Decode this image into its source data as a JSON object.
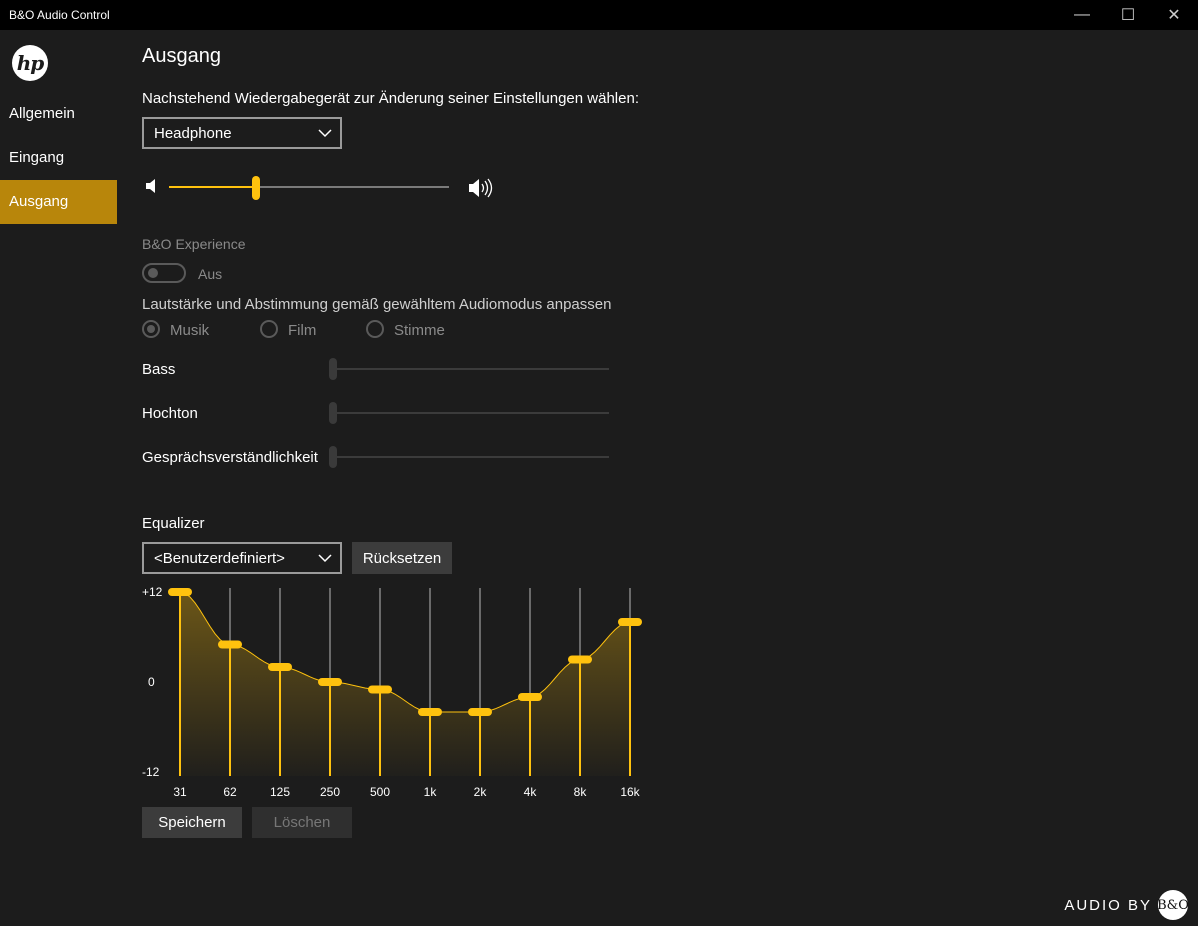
{
  "window": {
    "title": "B&O Audio Control",
    "minimize": "—",
    "maximize": "☐",
    "close": "✕"
  },
  "sidebar": {
    "logo": "hp",
    "items": [
      {
        "label": "Allgemein",
        "active": false
      },
      {
        "label": "Eingang",
        "active": false
      },
      {
        "label": "Ausgang",
        "active": true
      }
    ]
  },
  "page_title": "Ausgang",
  "device": {
    "prompt": "Nachstehend Wiedergabegerät zur Änderung seiner Einstellungen wählen:",
    "selected": "Headphone"
  },
  "volume": {
    "level": 0.31
  },
  "experience": {
    "label": "B&O Experience",
    "toggle_text": "Aus",
    "enabled": false
  },
  "mode": {
    "prompt": "Lautstärke und Abstimmung gemäß gewähltem Audiomodus anpassen",
    "options": [
      {
        "label": "Musik",
        "selected": true
      },
      {
        "label": "Film",
        "selected": false
      },
      {
        "label": "Stimme",
        "selected": false
      }
    ]
  },
  "tuning": [
    {
      "label": "Bass",
      "level": 0
    },
    {
      "label": "Hochton",
      "level": 0
    },
    {
      "label": "Gesprächsverständlichkeit",
      "level": 0
    }
  ],
  "equalizer": {
    "label": "Equalizer",
    "preset": "<Benutzerdefiniert>",
    "reset_label": "Rücksetzen",
    "y_labels": [
      "+12",
      "0",
      "-12"
    ],
    "ymax": 12,
    "ymin": -12,
    "bands": [
      "31",
      "62",
      "125",
      "250",
      "500",
      "1k",
      "2k",
      "4k",
      "8k",
      "16k"
    ],
    "values": [
      12,
      5,
      2,
      0,
      -1,
      -4,
      -4,
      -2,
      3,
      8
    ],
    "accent": "#ffc20e",
    "save_label": "Speichern",
    "delete_label": "Löschen"
  },
  "footer": {
    "text": "AUDIO BY",
    "logo": "B&O"
  }
}
